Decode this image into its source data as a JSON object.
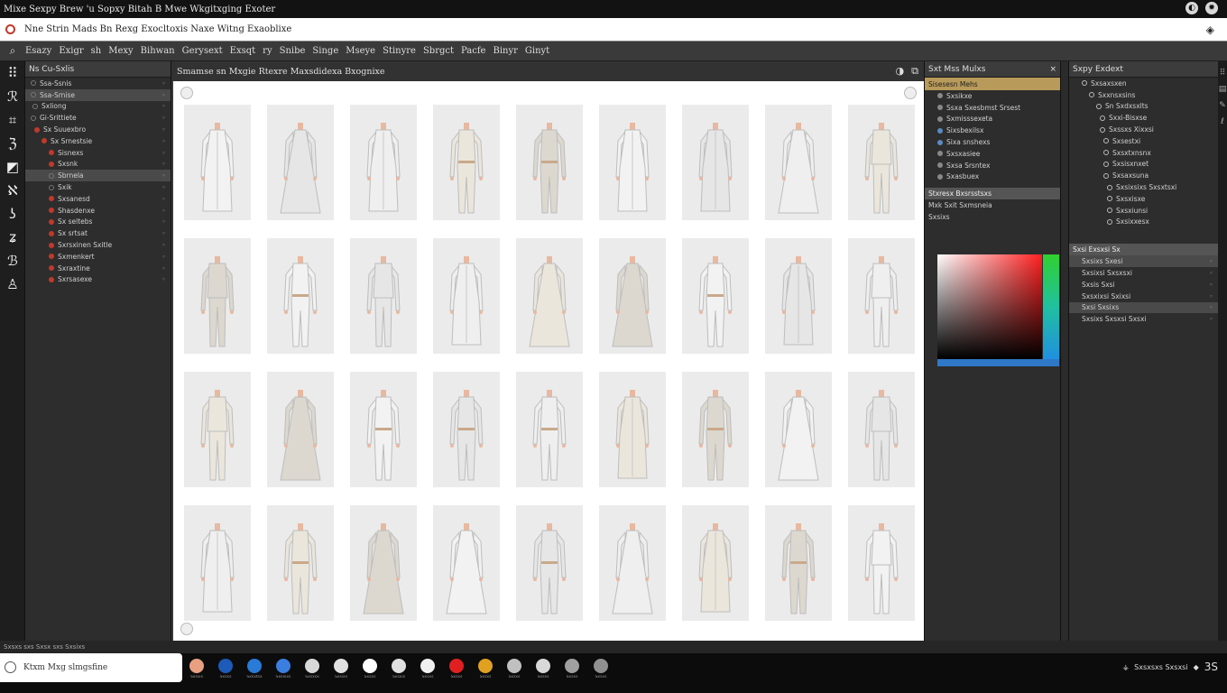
{
  "titlebar": {
    "title": "Mixe Sexpy Brew 'u Sopxy Bitah B Mwe Wkgitxging Exoter",
    "icons": [
      "globe-icon",
      "settings-icon"
    ]
  },
  "address": {
    "text": "Nne Strin Mads Bn Rexg Exocltoxis Naxe Witng Exaoblixe",
    "right_icon": "diamond-icon"
  },
  "menu": {
    "items": [
      "Esazy",
      "Exigr",
      "sh",
      "Mexy",
      "Bihwan",
      "Gerysext",
      "Exsqt",
      "ry",
      "Snibe",
      "Singe",
      "Mseye",
      "Stinyre",
      "Sbrgct",
      "Pacfe",
      "Binyr",
      "Ginyt"
    ]
  },
  "toolstrip": {
    "icons": [
      "grid-icon",
      "brush-icon",
      "frame-icon",
      "lasso-icon",
      "paint-icon",
      "pen-icon",
      "curve-icon",
      "text-icon",
      "shape-icon",
      "figure-icon"
    ]
  },
  "layers": {
    "header": "Ns Cu-Sxlis",
    "rows": [
      {
        "label": "Ssa-Ssnis",
        "color": "",
        "indent": 2
      },
      {
        "label": "Ssa-Srnise",
        "color": "",
        "indent": 2,
        "selected": true
      },
      {
        "label": "Sxliong",
        "color": "",
        "indent": 4
      },
      {
        "label": "Gi-Srittiete",
        "color": "",
        "indent": 2
      },
      {
        "label": "Sx Suuexbro",
        "color": "#c0392b",
        "indent": 6
      },
      {
        "label": "Sx Srnestsie",
        "color": "#c0392b",
        "indent": 14
      },
      {
        "label": "Sisnexs",
        "color": "#c0392b",
        "indent": 22
      },
      {
        "label": "Sxsnk",
        "color": "#c0392b",
        "indent": 22
      },
      {
        "label": "Sbrnela",
        "color": "",
        "indent": 22,
        "selected": true
      },
      {
        "label": "Sxik",
        "color": "",
        "indent": 22
      },
      {
        "label": "Sxsanesd",
        "color": "#c0392b",
        "indent": 22
      },
      {
        "label": "Shasdenxe",
        "color": "#c0392b",
        "indent": 22
      },
      {
        "label": "Sx seltebs",
        "color": "#c0392b",
        "indent": 22
      },
      {
        "label": "Sx srtsat",
        "color": "#c0392b",
        "indent": 22
      },
      {
        "label": "Sxrsxinen Sxitle",
        "color": "#c0392b",
        "indent": 22
      },
      {
        "label": "Sxmenkert",
        "color": "#c0392b",
        "indent": 22
      },
      {
        "label": "Sxraxtine",
        "color": "#c0392b",
        "indent": 22
      },
      {
        "label": "Sxrsasexe",
        "color": "#c0392b",
        "indent": 22
      }
    ]
  },
  "canvas": {
    "tab_label": "Smamse sn Mxgie Rtexre Maxsdidexa Bxognixe"
  },
  "grid": {
    "columns": 9,
    "rows": 4,
    "items": [
      "coat",
      "dress",
      "coat",
      "jumpsuit",
      "jumpsuit",
      "coat",
      "coat",
      "dress",
      "suit",
      "suit",
      "jumpsuit",
      "suit",
      "coat",
      "dress",
      "dress",
      "jumpsuit",
      "coat",
      "suit",
      "suit",
      "dress",
      "jumpsuit",
      "jumpsuit",
      "jumpsuit",
      "coat",
      "jumpsuit",
      "dress",
      "suit",
      "coat",
      "jumpsuit",
      "dress",
      "dress",
      "jumpsuit",
      "dress",
      "coat",
      "jumpsuit",
      "suit"
    ]
  },
  "props": {
    "header": "Sxt Mss Mulxs",
    "gold_row": "Sisesesn Mehs",
    "rows": [
      {
        "label": "Sxsikxe",
        "color": ""
      },
      {
        "label": "Ssxa Sxesbmst Srsest",
        "color": ""
      },
      {
        "label": "Sxmisssexeta",
        "color": ""
      },
      {
        "label": "Sixsbexilsx",
        "color": "#5a8ac0"
      },
      {
        "label": "Sixa snshexs",
        "color": "#5a8ac0"
      },
      {
        "label": "Sxsxasiee",
        "color": ""
      },
      {
        "label": "Sxsa Srsntex",
        "color": ""
      },
      {
        "label": "Sxasbuex",
        "color": ""
      }
    ],
    "section1": "Stxresx Bxsrsstsxs",
    "section2": "Mxk Sxit Sxmsneia",
    "section3": "Sxsixs"
  },
  "outline": {
    "header": "Sxpy Exdext",
    "rows": [
      {
        "label": "Sxsaxsxen",
        "indent": 8
      },
      {
        "label": "Sxxnsxsins",
        "indent": 16
      },
      {
        "label": "Sn Sxdxsxlts",
        "indent": 24
      },
      {
        "label": "Sxxi-Bisxse",
        "indent": 28
      },
      {
        "label": "Sxssxs Xixxsi",
        "indent": 28
      },
      {
        "label": "Sxsestxi",
        "indent": 32
      },
      {
        "label": "Sxsxtxnsnx",
        "indent": 32
      },
      {
        "label": "Sxsisxnxet",
        "indent": 32
      },
      {
        "label": "Sxsaxsuna",
        "indent": 32
      },
      {
        "label": "Sxsixsixs Sxsxtsxi",
        "indent": 36
      },
      {
        "label": "Sxsxisxe",
        "indent": 36
      },
      {
        "label": "Sxsxiunsi",
        "indent": 36
      },
      {
        "label": "Sxsixxesx",
        "indent": 36
      }
    ],
    "section": "Sxsi Exsxsi Sx",
    "rows2": [
      {
        "label": "Sxsixs Sxesi",
        "sel": true
      },
      {
        "label": "Sxsixsi Sxsxsxi",
        "sel": false
      },
      {
        "label": "Sxsis Sxsi",
        "sel": false
      },
      {
        "label": "Sxsxixsi Sxixsi",
        "sel": false
      },
      {
        "label": "Sxsi Sxsixs",
        "sel": true
      },
      {
        "label": "Sxsixs Sxsxsi Sxsxi",
        "sel": false
      }
    ]
  },
  "status": {
    "text": "Sxsxs sxs  Sxsx sxs  Sxsixs"
  },
  "taskbar": {
    "search_text": "Ktxm Mxg slmgsfine",
    "apps": [
      {
        "color": "#e8a080",
        "label": "Sxsixs"
      },
      {
        "color": "#1e5ab8",
        "label": "Sxsxs"
      },
      {
        "color": "#2a7ad8",
        "label": "Sxsxtsx"
      },
      {
        "color": "#3a7ee0",
        "label": "Sxsxixs"
      },
      {
        "color": "#d8d8d8",
        "label": "Sxsxsx"
      },
      {
        "color": "#e0e0e0",
        "label": "Sxsixs"
      },
      {
        "color": "#ffffff",
        "label": "Sxsxs"
      },
      {
        "color": "#e0e0e0",
        "label": "Sxsxis"
      },
      {
        "color": "#f0f0f0",
        "label": "Sxsxs"
      },
      {
        "color": "#e02020",
        "label": "Sxsxs"
      },
      {
        "color": "#e0a020",
        "label": "Sxsxs"
      },
      {
        "color": "#c0c0c0",
        "label": "Sxsxs"
      },
      {
        "color": "#d8d8d8",
        "label": "Sxsxs"
      },
      {
        "color": "#a0a0a0",
        "label": "Sxsxs"
      },
      {
        "color": "#909090",
        "label": "Sxsxs"
      }
    ],
    "tray_text": "Sxsxsxs Sxsxsi",
    "clock": "3S"
  }
}
